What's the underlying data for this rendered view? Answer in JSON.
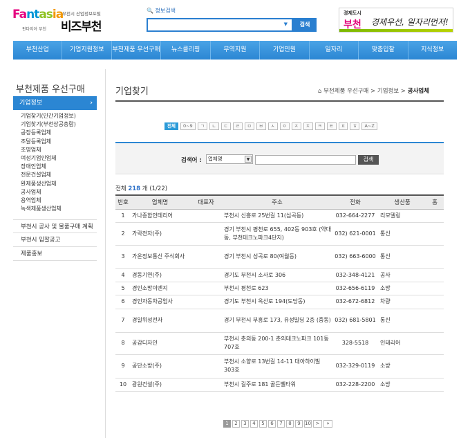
{
  "header": {
    "logo_text": "Fantasia",
    "logo_subtext": "판타지아 부천",
    "portal_small": "부천시 산업정보포털",
    "portal_name": "비즈부천",
    "search_label": "정보검색",
    "search_value": "",
    "search_button": "검색",
    "banner_city": "경제도시",
    "banner_name": "부천",
    "banner_slogan": "경제우선, 일자리먼저!"
  },
  "nav": [
    "부천산업",
    "기업지원정보",
    "부천제품 우선구매",
    "뉴스클리핑",
    "무역지원",
    "기업민원",
    "일자리",
    "맞춤입찰",
    "지식정보"
  ],
  "sidebar": {
    "title": "부천제품 우선구매",
    "active": "기업정보",
    "sub_items": [
      "기업찾기(민간기업정보)",
      "기업찾기(부천상공총람)",
      "공장등록업체",
      "조달등록업체",
      "조명업체",
      "여성기업인업체",
      "장애인업체",
      "전문건설업체",
      "완제품생산업체",
      "공사업체",
      "용역업체",
      "녹색제품생산업체"
    ],
    "links": [
      "부천시 공사 및 물품구매 계획",
      "부천시 입찰공고",
      "제품홍보"
    ]
  },
  "main": {
    "title": "기업찾기",
    "breadcrumb": [
      "부천제품 우선구매",
      "기업정보",
      "공사업체"
    ],
    "consonants": [
      "전체",
      "0~9",
      "ㄱ",
      "ㄴ",
      "ㄷ",
      "ㄹ",
      "ㅁ",
      "ㅂ",
      "ㅅ",
      "ㅇ",
      "ㅈ",
      "ㅊ",
      "ㅋ",
      "ㅌ",
      "ㅍ",
      "ㅎ",
      "A~Z"
    ],
    "search_label": "검색어 :",
    "search_select": "업체명",
    "search_button": "검색",
    "count_prefix": "전체",
    "count_total": "218",
    "count_suffix": "개 (1/22)"
  },
  "table": {
    "headers": [
      "번호",
      "업체명",
      "대표자",
      "주소",
      "전화",
      "생산품",
      "홈"
    ],
    "rows": [
      {
        "no": "1",
        "name": "가나종합인테리어",
        "rep": "",
        "addr": "부천시 신흥로 25번길 11(심곡동)",
        "tel": "032-664-2277",
        "product": "리모델링"
      },
      {
        "no": "2",
        "name": "가락전자(주)",
        "rep": "",
        "addr": "경기 부천시 평천로 655, 402동 903호 (약대동, 부천테크노파크4단지)",
        "tel": "032) 621-0001",
        "product": "통신"
      },
      {
        "no": "3",
        "name": "가온정보통신 주식회사",
        "rep": "",
        "addr": "경기 부천시 성곡로 80(여월동)",
        "tel": "032) 663-6000",
        "product": "통신"
      },
      {
        "no": "4",
        "name": "경동기연(주)",
        "rep": "",
        "addr": "경기도 부천시 소사로 306",
        "tel": "032-348-4121",
        "product": "공사"
      },
      {
        "no": "5",
        "name": "경인소방이엔지",
        "rep": "",
        "addr": "부천시 평천로 623",
        "tel": "032-656-6119",
        "product": "소방"
      },
      {
        "no": "6",
        "name": "경인자동차공업사",
        "rep": "",
        "addr": "경기도 부천시 옥산로 194(도당동)",
        "tel": "032-672-6812",
        "product": "차량"
      },
      {
        "no": "7",
        "name": "경일위성전자",
        "rep": "",
        "addr": "경기 부천시 부흥로 173, 유성빌딩 2층 (중동)",
        "tel": "032) 681-5801",
        "product": "통신"
      },
      {
        "no": "8",
        "name": "공감디자인",
        "rep": "",
        "addr": "부천시 춘의동 200-1 춘의테크노파크 101동 707호",
        "tel": "328-5518",
        "product": "인테리어"
      },
      {
        "no": "9",
        "name": "공단소방(주)",
        "rep": "",
        "addr": "부천시 소향로 13번길 14-11 대아하이빌 303호",
        "tel": "032-329-0119",
        "product": "소방"
      },
      {
        "no": "10",
        "name": "광원건설(주)",
        "rep": "",
        "addr": "부천시 길주로 181 골든벨타워",
        "tel": "032-228-2200",
        "product": "소방"
      }
    ]
  },
  "pager": {
    "pages": [
      "1",
      "2",
      "3",
      "4",
      "5",
      "6",
      "7",
      "8",
      "9",
      "10"
    ],
    "current": "1",
    "next": ">",
    "last": "»"
  },
  "colors": {
    "brand_blue": "#2b86d3",
    "accent_pink": "#e2007a",
    "count_blue": "#2b6fc8"
  }
}
